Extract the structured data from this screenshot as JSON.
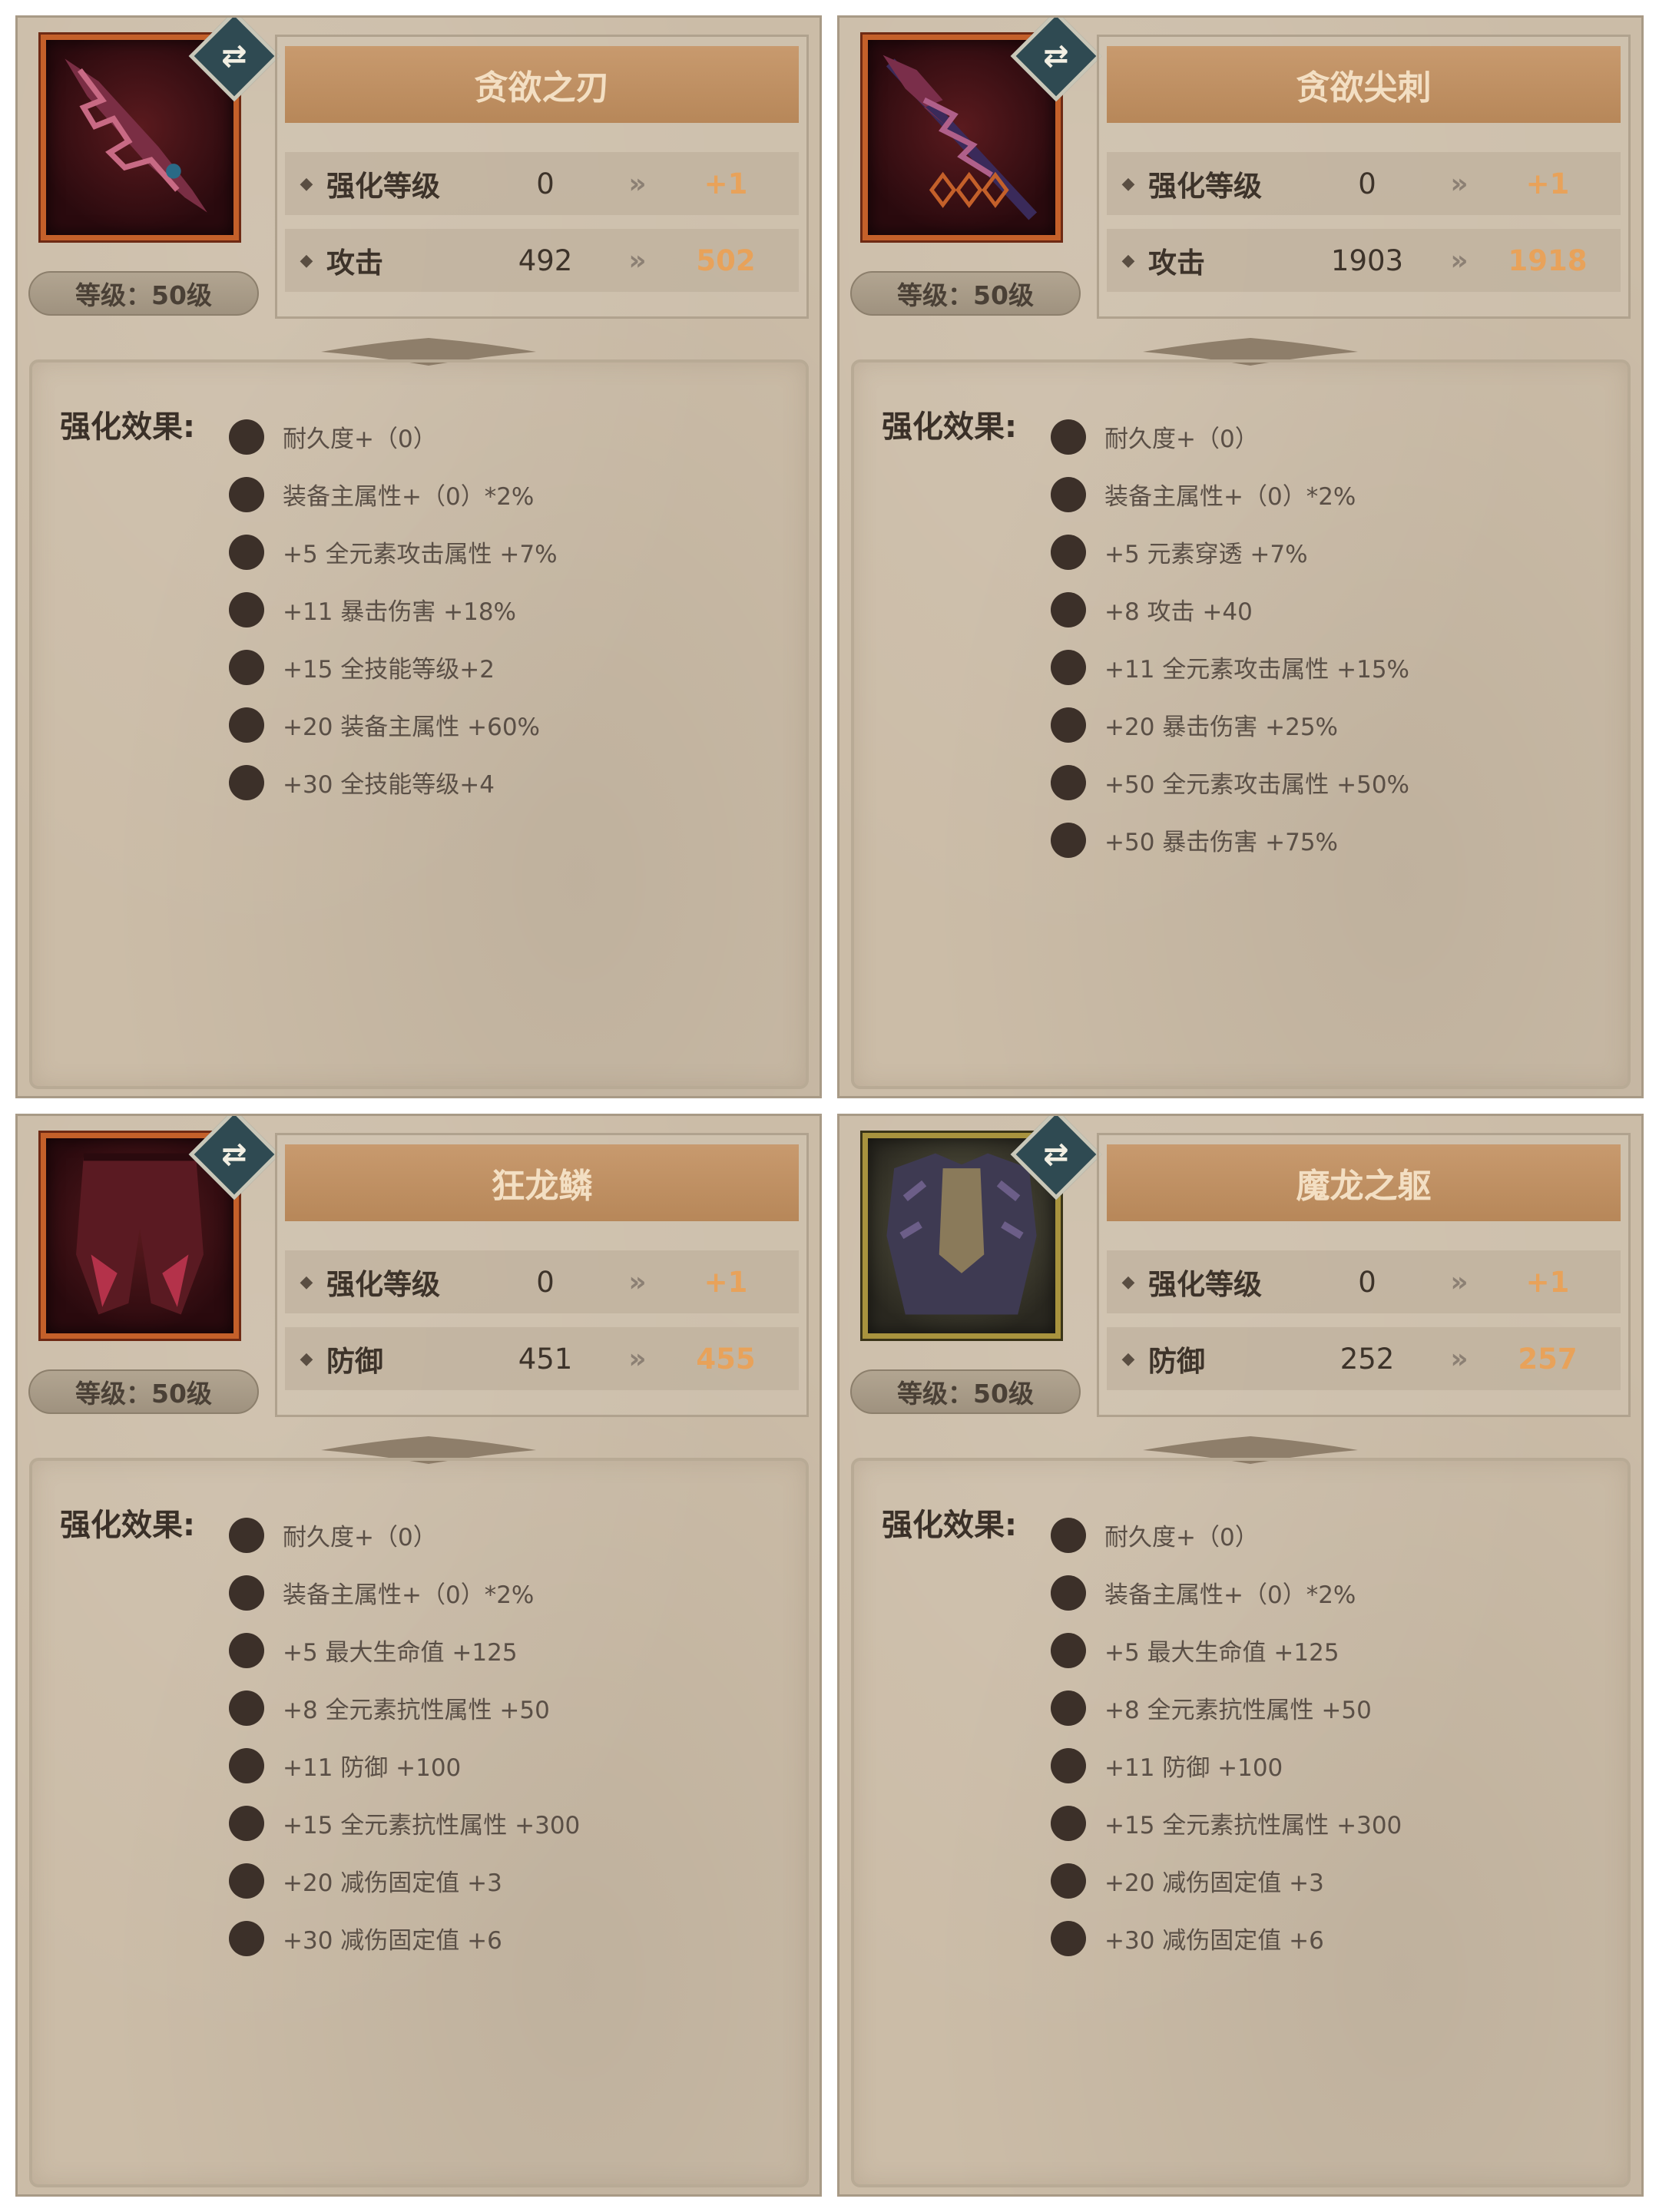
{
  "cards": [
    {
      "title": "贪欲之刃",
      "level": "等级：50级",
      "stats": [
        {
          "name": "强化等级",
          "current": "0",
          "next": "+1"
        },
        {
          "name": "攻击",
          "current": "492",
          "next": "502"
        }
      ],
      "effects_label": "强化效果:",
      "effects": [
        "耐久度+（0）",
        "装备主属性+（0）*2%",
        "+5 全元素攻击属性 +7%",
        "+11 暴击伤害 +18%",
        "+15 全技能等级+2",
        "+20 装备主属性 +60%",
        "+30 全技能等级+4"
      ],
      "icon": "sword-icon"
    },
    {
      "title": "贪欲尖刺",
      "level": "等级：50级",
      "stats": [
        {
          "name": "强化等级",
          "current": "0",
          "next": "+1"
        },
        {
          "name": "攻击",
          "current": "1903",
          "next": "1918"
        }
      ],
      "effects_label": "强化效果:",
      "effects": [
        "耐久度+（0）",
        "装备主属性+（0）*2%",
        "+5 元素穿透 +7%",
        "+8 攻击 +40",
        "+11 全元素攻击属性 +15%",
        "+20 暴击伤害 +25%",
        "+50 全元素攻击属性 +50%",
        "+50 暴击伤害 +75%"
      ],
      "icon": "spear-icon"
    },
    {
      "title": "狂龙鳞",
      "level": "等级：50级",
      "stats": [
        {
          "name": "强化等级",
          "current": "0",
          "next": "+1"
        },
        {
          "name": "防御",
          "current": "451",
          "next": "455"
        }
      ],
      "effects_label": "强化效果:",
      "effects": [
        "耐久度+（0）",
        "装备主属性+（0）*2%",
        "+5 最大生命值 +125",
        "+8 全元素抗性属性 +50",
        "+11 防御 +100",
        "+15 全元素抗性属性 +300",
        "+20 减伤固定值 +3",
        "+30 减伤固定值 +6"
      ],
      "icon": "leg-armor-icon"
    },
    {
      "title": "魔龙之躯",
      "level": "等级：50级",
      "stats": [
        {
          "name": "强化等级",
          "current": "0",
          "next": "+1"
        },
        {
          "name": "防御",
          "current": "252",
          "next": "257"
        }
      ],
      "effects_label": "强化效果:",
      "effects": [
        "耐久度+（0）",
        "装备主属性+（0）*2%",
        "+5 最大生命值 +125",
        "+8 全元素抗性属性 +50",
        "+11 防御 +100",
        "+15 全元素抗性属性 +300",
        "+20 减伤固定值 +3",
        "+30 减伤固定值 +6"
      ],
      "icon": "body-armor-icon"
    }
  ],
  "colors": {
    "next_value": "#e8a25a",
    "title_text": "#f3dfc3",
    "parchment": "#cbbca7"
  }
}
